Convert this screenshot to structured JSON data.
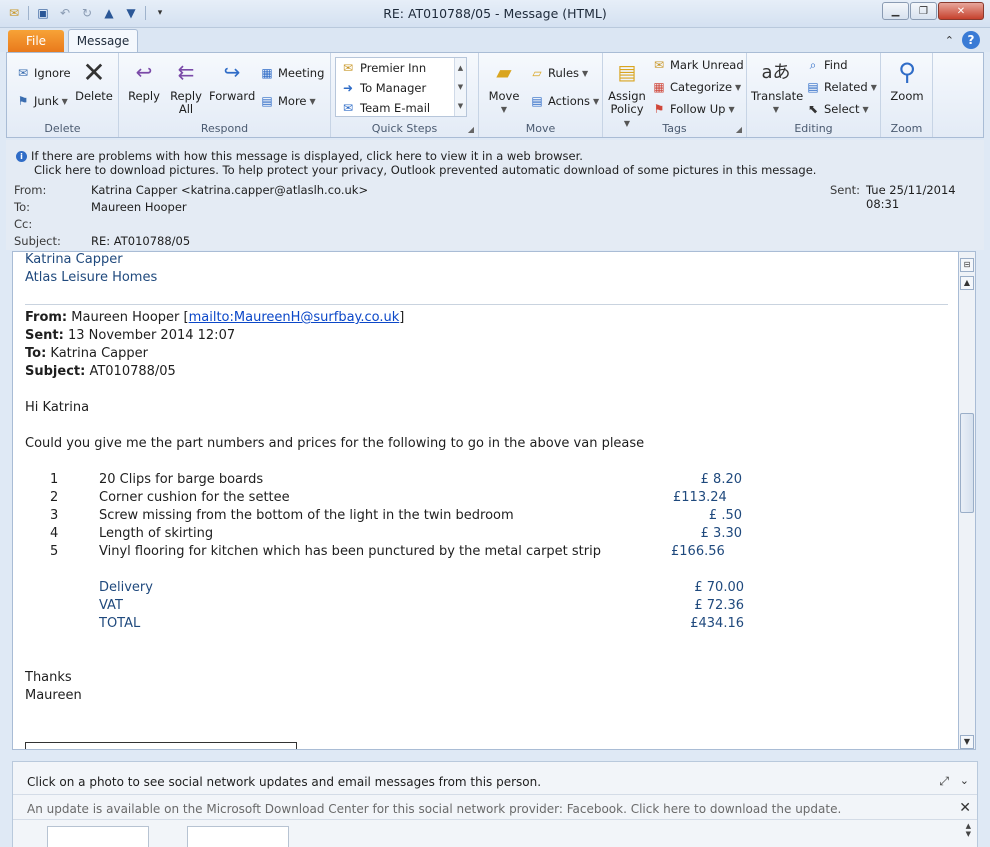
{
  "window": {
    "title": "RE: AT010788/05  -  Message (HTML)"
  },
  "tabs": [
    {
      "label": "File"
    },
    {
      "label": "Message"
    }
  ],
  "ribbon": {
    "delete": {
      "ignore": "Ignore",
      "junk": "Junk",
      "delete": "Delete",
      "label": "Delete"
    },
    "respond": {
      "reply": "Reply",
      "reply_all_1": "Reply",
      "reply_all_2": "All",
      "forward": "Forward",
      "meeting": "Meeting",
      "more": "More",
      "label": "Respond"
    },
    "quick_steps": {
      "items": [
        "Premier Inn",
        "To Manager",
        "Team E-mail"
      ],
      "label": "Quick Steps"
    },
    "move": {
      "move": "Move",
      "rules": "Rules",
      "actions": "Actions",
      "label": "Move"
    },
    "tags": {
      "assign_1": "Assign",
      "assign_2": "Policy",
      "mark_unread": "Mark Unread",
      "categorize": "Categorize",
      "follow_up": "Follow Up",
      "label": "Tags"
    },
    "editing": {
      "translate": "Translate",
      "find": "Find",
      "related": "Related",
      "select": "Select",
      "label": "Editing"
    },
    "zoom": {
      "zoom": "Zoom",
      "label": "Zoom"
    }
  },
  "info_bar": {
    "line1": "If there are problems with how this message is displayed, click here to view it in a web browser.",
    "line2": "Click here to download pictures. To help protect your privacy, Outlook prevented automatic download of some pictures in this message."
  },
  "header": {
    "from_label": "From:",
    "from_value": "Katrina Capper <katrina.capper@atlaslh.co.uk>",
    "to_label": "To:",
    "to_value": "Maureen Hooper",
    "cc_label": "Cc:",
    "subject_label": "Subject:",
    "subject_value": "RE: AT010788/05",
    "sent_label": "Sent:",
    "sent_value": "Tue 25/11/2014 08:31"
  },
  "body": {
    "sig_name": "Katrina Capper",
    "sig_company": "Atlas Leisure Homes",
    "quoted": {
      "from_label": "From:",
      "from_name": " Maureen Hooper [",
      "from_link": "mailto:MaureenH@surfbay.co.uk",
      "from_end": "]",
      "sent_label": "Sent:",
      "sent_value": " 13 November 2014 12:07",
      "to_label": "To:",
      "to_value": " Katrina Capper",
      "subject_label": "Subject:",
      "subject_value": " AT010788/05"
    },
    "greeting": "Hi Katrina",
    "request": "Could you give me the part numbers and prices for the following to go in the above van please",
    "items": [
      {
        "num": "1",
        "desc": "20 Clips for barge boards",
        "price": "£   8.20"
      },
      {
        "num": "2",
        "desc": "Corner cushion for the settee",
        "price": "£113.24"
      },
      {
        "num": "3",
        "desc": "Screw missing from the bottom of the light in the twin bedroom",
        "price": "£     .50"
      },
      {
        "num": "4",
        "desc": "Length of skirting",
        "price": "£   3.30"
      },
      {
        "num": "5",
        "desc": "Vinyl flooring for kitchen which has been punctured by the metal carpet strip",
        "price": "£166.56"
      }
    ],
    "totals": [
      {
        "label": "Delivery",
        "value": "£  70.00"
      },
      {
        "label": "VAT",
        "value": "£  72.36"
      },
      {
        "label": "TOTAL",
        "value": "£434.16"
      }
    ],
    "thanks": "Thanks",
    "signoff": "Maureen"
  },
  "social": {
    "prompt": "Click on a photo to see social network updates and email messages from this person.",
    "update": "An update is available on the Microsoft Download Center for this social network provider: Facebook. Click here to download the update."
  },
  "colors": {
    "accent_blue": "#1f497d",
    "file_tab": "#e9791c",
    "link": "#0b47c8"
  }
}
